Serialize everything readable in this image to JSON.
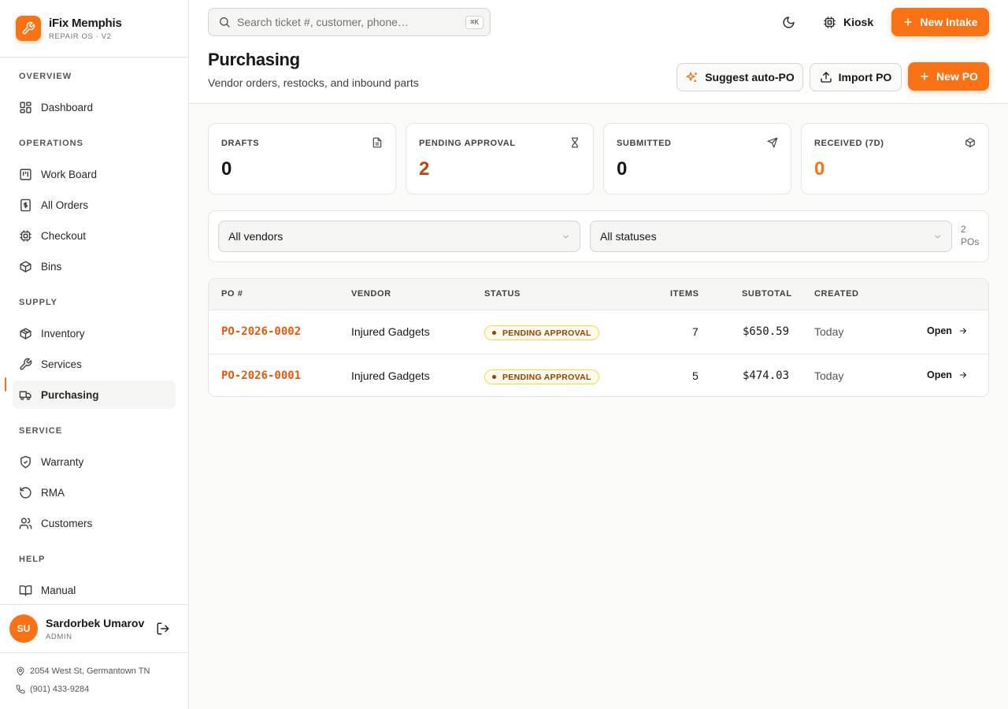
{
  "brand": {
    "name": "iFix Memphis",
    "subtitle": "REPAIR OS · V2"
  },
  "sidebar": {
    "sections": [
      {
        "title": "OVERVIEW",
        "items": [
          {
            "label": "Dashboard",
            "icon": "dashboard-icon"
          }
        ]
      },
      {
        "title": "OPERATIONS",
        "items": [
          {
            "label": "Work Board",
            "icon": "kanban-icon"
          },
          {
            "label": "All Orders",
            "icon": "receipt-icon"
          },
          {
            "label": "Checkout",
            "icon": "chip-icon"
          },
          {
            "label": "Bins",
            "icon": "box-icon"
          }
        ]
      },
      {
        "title": "SUPPLY",
        "items": [
          {
            "label": "Inventory",
            "icon": "package-icon"
          },
          {
            "label": "Services",
            "icon": "wrench-icon"
          },
          {
            "label": "Purchasing",
            "icon": "truck-icon",
            "active": true
          }
        ]
      },
      {
        "title": "SERVICE",
        "items": [
          {
            "label": "Warranty",
            "icon": "shield-check-icon"
          },
          {
            "label": "RMA",
            "icon": "rotate-ccw-icon"
          },
          {
            "label": "Customers",
            "icon": "users-icon"
          }
        ]
      },
      {
        "title": "HELP",
        "items": [
          {
            "label": "Manual",
            "icon": "book-icon"
          }
        ]
      }
    ],
    "user": {
      "initials": "SU",
      "name": "Sardorbek Umarov",
      "role": "ADMIN"
    },
    "store": {
      "address": "2054 West St, Germantown TN",
      "phone": "(901) 433-9284"
    }
  },
  "header": {
    "search_placeholder": "Search ticket #, customer, phone…",
    "search_shortcut": "⌘K",
    "kiosk_label": "Kiosk",
    "new_intake_label": "New Intake"
  },
  "page": {
    "title": "Purchasing",
    "subtitle": "Vendor orders, restocks, and inbound parts",
    "actions": {
      "suggest": "Suggest auto-PO",
      "import": "Import PO",
      "new_po": "New PO"
    }
  },
  "stats": [
    {
      "label": "DRAFTS",
      "value": "0",
      "icon": "file-icon",
      "color": "#18181b"
    },
    {
      "label": "PENDING APPROVAL",
      "value": "2",
      "icon": "hourglass-icon",
      "color": "#c2410c"
    },
    {
      "label": "SUBMITTED",
      "value": "0",
      "icon": "send-icon",
      "color": "#18181b"
    },
    {
      "label": "RECEIVED (7D)",
      "value": "0",
      "icon": "package-check-icon",
      "color": "#f97316"
    }
  ],
  "filters": {
    "vendor": "All vendors",
    "status": "All statuses",
    "count": "2 POs"
  },
  "table": {
    "columns": [
      "PO #",
      "VENDOR",
      "STATUS",
      "ITEMS",
      "SUBTOTAL",
      "CREATED"
    ],
    "rows": [
      {
        "po": "PO-2026-0002",
        "vendor": "Injured Gadgets",
        "status": "PENDING APPROVAL",
        "items": "7",
        "subtotal": "$650.59",
        "created": "Today",
        "action": "Open"
      },
      {
        "po": "PO-2026-0001",
        "vendor": "Injured Gadgets",
        "status": "PENDING APPROVAL",
        "items": "5",
        "subtotal": "$474.03",
        "created": "Today",
        "action": "Open"
      }
    ]
  },
  "colors": {
    "accent": "#f97316",
    "accent_dark": "#ea580c",
    "badge_bg": "#fffbeb",
    "badge_text": "#92400e"
  }
}
